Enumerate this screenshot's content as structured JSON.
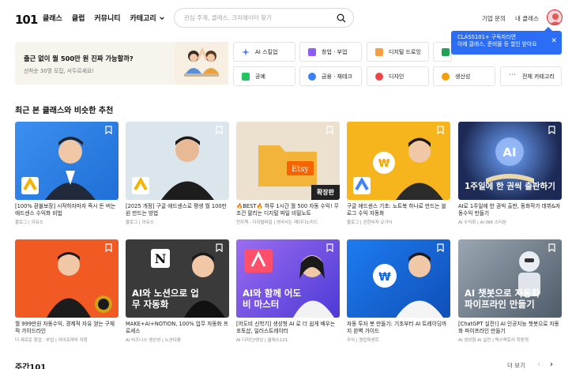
{
  "header": {
    "logo": "101",
    "nav": [
      "클래스",
      "클럽",
      "커뮤니티"
    ],
    "category_dropdown": "카테고리",
    "search_placeholder": "관심 주제, 클래스, 크리에이터 찾기",
    "links": [
      "기업 문의",
      "내 클래스"
    ]
  },
  "tooltip": {
    "line1": "CLASS101+ 구독자라면",
    "line2": "이제 클래스, 준비물 등 할인 받아요"
  },
  "promo": {
    "title": "출근 없이 월 500만 원 진짜 가능할까?",
    "subtitle": "선착순 30명 모집, 서두르세요!"
  },
  "categories": [
    {
      "label": "AI 스킬업",
      "color": "#e9f0ff"
    },
    {
      "label": "창업 · 부업",
      "color": "#8b5cf6"
    },
    {
      "label": "디지털 드로잉",
      "color": "#f59e42"
    },
    {
      "label": "",
      "color": "#22a35a"
    },
    {
      "label": "공예",
      "color": "#22c55e"
    },
    {
      "label": "금융 · 재테크",
      "color": "#3b82f6"
    },
    {
      "label": "디자인",
      "color": "#ef4444"
    },
    {
      "label": "생산성",
      "color": "#f59e0b"
    },
    {
      "label": "전체 카테고리",
      "color": "#ffffff"
    }
  ],
  "section_title": "최근 본 클래스와 비슷한 추천",
  "cards": [
    {
      "title": "[100% 환불보장] 시작하자마자 즉시 돈 버는 애드센스 수익화 비법",
      "meta": "블로그 | 이유스",
      "bg": "#2f7fe0",
      "overlay": ""
    },
    {
      "title": "[2025 개정] 구글 애드센스로 평생 월 100만원 만드는 방법",
      "meta": "블로그 | 이유스",
      "bg": "#d9e4ea",
      "overlay": ""
    },
    {
      "title": "🔥BEST🔥 하루 1시간 월 500 자동 수익! 무조건 팔리는 디지털 파일 비밀노트",
      "meta": "전자책 · 디지털파일 | 영국사는 레이디노마드",
      "bg": "#e9d9c6",
      "overlay": "확장판"
    },
    {
      "title": "구글 애드센스 기초: 노트북 하나로 만드는 블로그 수익 자동화",
      "meta": "블로그 | 선한부자 오가닉",
      "bg": "#f6b31c",
      "overlay": ""
    },
    {
      "title": "AI로 1주일에 한 권씩 출판, 동화작가 데뷔&자동수익 만들기",
      "meta": "AI 수익화 | AI INK 스티븐",
      "bg": "#1d2a55",
      "overlay": "1주일에 한 권씩 출판하기"
    },
    {
      "title": "월 999만원 자동수익, 경제적 자유 얻는 구체적 가이드라인",
      "meta": "더 새로운 창업 · 부업 | 라이프파머 자청",
      "bg": "#f15a22",
      "overlay": ""
    },
    {
      "title": "MAKE+AI+NOTION, 100% 업무 자동화 프로세스",
      "meta": "AI 비즈니스 생산성 | 노션다움",
      "bg": "#3a3a3a",
      "overlay": "AI와 노션으로 업무 자동화"
    },
    {
      "title": "[어도비 신학기] 생성형 AI 로 더 쉽게 배우는 포토샵, 일러스트레이터",
      "meta": "AI 디자인/영상 | 클래스101",
      "bg": "#7d4de0",
      "overlay": "AI와 함께 어도비 마스터"
    },
    {
      "title": "자동 투자 봇 만들기: 기초부터 AI 트레이딩까지 완벽 가이드",
      "meta": "주식 | 퀀탑퍼센트",
      "bg": "#1565d8",
      "overlay": ""
    },
    {
      "title": "[ChatGPT 실전!] AI 인공지능 챗봇으로 자동화 파이프라인 만들기",
      "meta": "AI 생성형 AI 실전 | 텍스팩토리 최동혁",
      "bg": "#6d7a88",
      "overlay": "AI 챗봇으로 자동화 파이프라인 만들기"
    }
  ],
  "weekly_title": "주간101",
  "more_label": "더 보기"
}
